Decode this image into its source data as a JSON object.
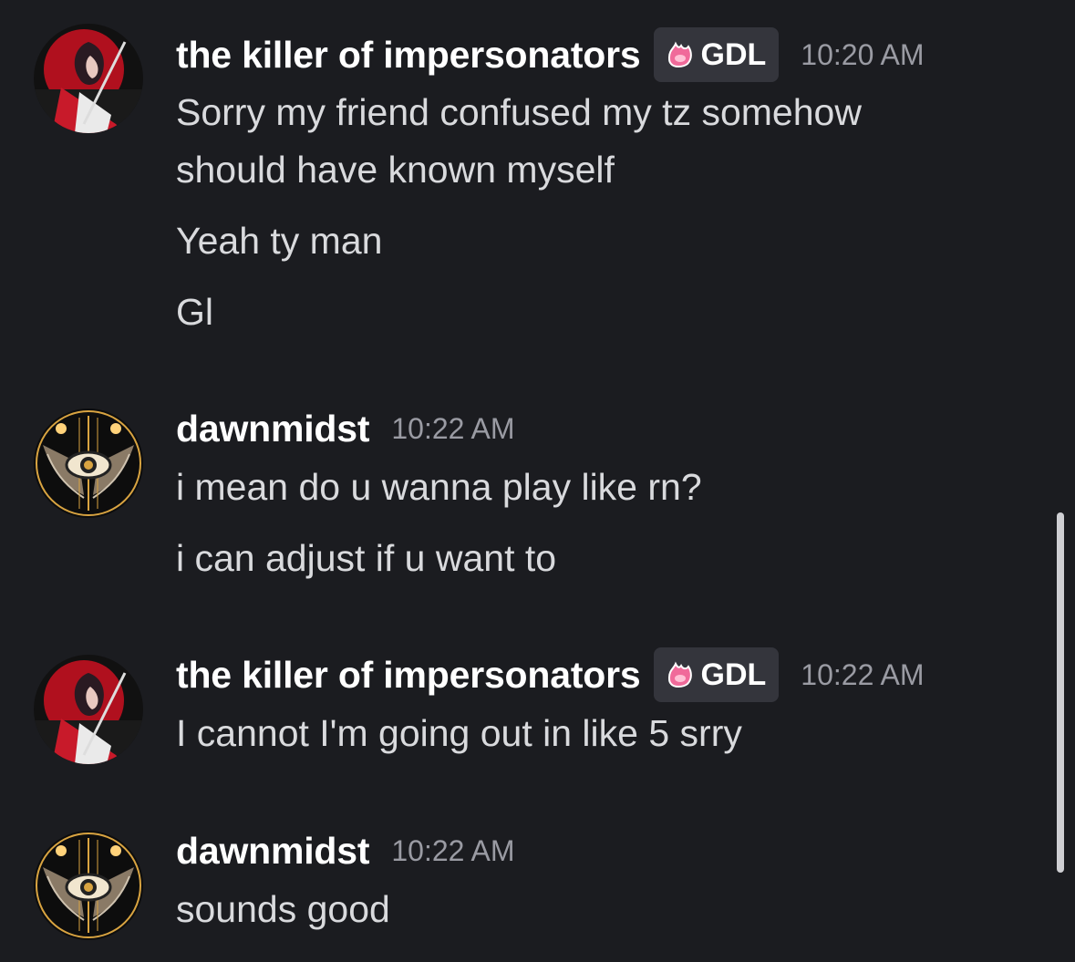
{
  "messages": [
    {
      "author": "the killer of impersonators",
      "tag": "GDL",
      "time": "10:20 AM",
      "lines": [
        "Sorry my friend confused my tz somehow",
        "should have known myself",
        "Yeah ty man",
        "Gl"
      ]
    },
    {
      "author": "dawnmidst",
      "time": "10:22 AM",
      "lines": [
        "i mean do u wanna play like rn?",
        "i can adjust if u want to"
      ]
    },
    {
      "author": "the killer of impersonators",
      "tag": "GDL",
      "time": "10:22 AM",
      "lines": [
        "I cannot I'm going out in like 5 srry"
      ]
    },
    {
      "author": "dawnmidst",
      "time": "10:22 AM",
      "lines": [
        "sounds good"
      ]
    }
  ],
  "colors": {
    "background": "#1b1c20",
    "username": "#ffffff",
    "message_text": "#d9dadd",
    "timestamp": "#9a9ba3",
    "tag_background": "#34353c",
    "tag_icon": "#f06a9a"
  },
  "icons": {
    "tag_icon": "pink-flame-icon",
    "avatar_1": "anime-swordsman-avatar",
    "avatar_2": "winged-eye-avatar"
  }
}
